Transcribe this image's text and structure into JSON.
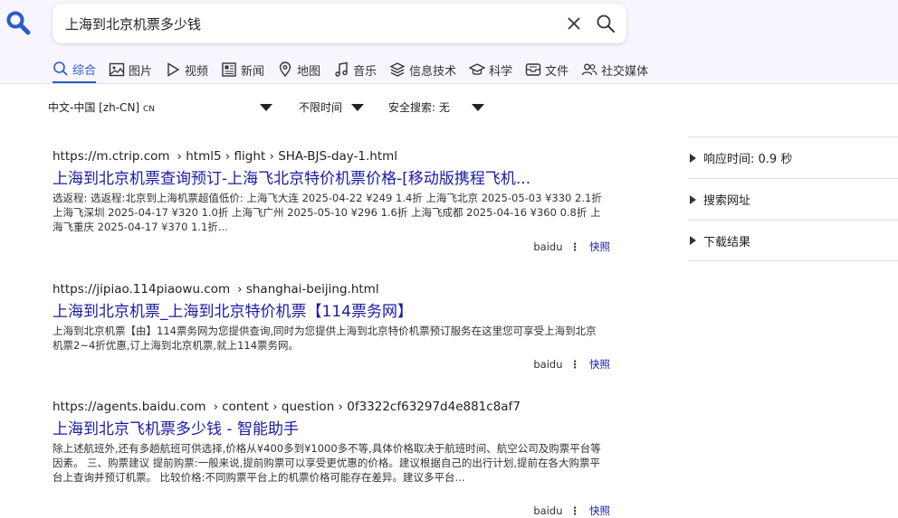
{
  "search": {
    "query": "上海到北京机票多少钱"
  },
  "tabs": [
    {
      "label": "综合",
      "icon": "search-icon",
      "active": true
    },
    {
      "label": "图片",
      "icon": "image-icon"
    },
    {
      "label": "视频",
      "icon": "play-icon"
    },
    {
      "label": "新闻",
      "icon": "newspaper-icon"
    },
    {
      "label": "地图",
      "icon": "map-pin-icon"
    },
    {
      "label": "音乐",
      "icon": "music-icon"
    },
    {
      "label": "信息技术",
      "icon": "layers-icon"
    },
    {
      "label": "科学",
      "icon": "graduation-cap-icon"
    },
    {
      "label": "文件",
      "icon": "inbox-icon"
    },
    {
      "label": "社交媒体",
      "icon": "people-icon"
    }
  ],
  "filters": {
    "language": "中文-中国 [zh-CN]",
    "language_code": "CN",
    "time": "不限时间",
    "safe_search": "安全搜索: 无"
  },
  "results": [
    {
      "url_host": "https://m.ctrip.com",
      "url_path": "› html5 › flight › SHA-BJS-day-1.html",
      "title": "上海到北京机票查询预订-上海飞北京特价机票价格-[移动版携程飞机...",
      "snippet": "选返程: 选返程:北京到上海机票超值低价: 上海飞大连 2025-04-22 ¥249 1.4折 上海飞北京 2025-05-03 ¥330 2.1折 上海飞深圳 2025-04-17 ¥320 1.0折 上海飞广州 2025-05-10 ¥296 1.6折 上海飞成都 2025-04-16 ¥360 0.8折 上海飞重庆 2025-04-17 ¥370 1.1折...",
      "engine": "baidu",
      "cache": "快照"
    },
    {
      "url_host": "https://jipiao.114piaowu.com",
      "url_path": "› shanghai-beijing.html",
      "title": "上海到北京机票_上海到北京特价机票【114票务网】",
      "snippet": "上海到北京机票【由】114票务网为您提供查询,同时为您提供上海到北京特价机票预订服务在这里您可享受上海到北京机票2~4折优惠,订上海到北京机票,就上114票务网。",
      "engine": "baidu",
      "cache": "快照"
    },
    {
      "url_host": "https://agents.baidu.com",
      "url_path": "› content › question › 0f3322cf63297d4e881c8af7",
      "title": "上海到北京飞机票多少钱 - 智能助手",
      "snippet": "除上述航班外,还有多趟航班可供选择,价格从¥400多到¥1000多不等,具体价格取决于航班时间、航空公司及购票平台等因素。 三、购票建议 提前购票:一般来说,提前购票可以享受更优惠的价格。建议根据自己的出行计划,提前在各大购票平台上查询并预订机票。 比较价格:不同购票平台上的机票价格可能存在差异。建议多平台...",
      "engine": "baidu",
      "cache": "快照"
    }
  ],
  "sidebar": {
    "items": [
      {
        "label": "响应时间: 0.9 秒"
      },
      {
        "label": "搜索网址"
      },
      {
        "label": "下载结果"
      }
    ]
  },
  "colors": {
    "accent": "#2a5cc9",
    "link": "#1a1aa6",
    "header_bg": "#f7f5fd"
  }
}
